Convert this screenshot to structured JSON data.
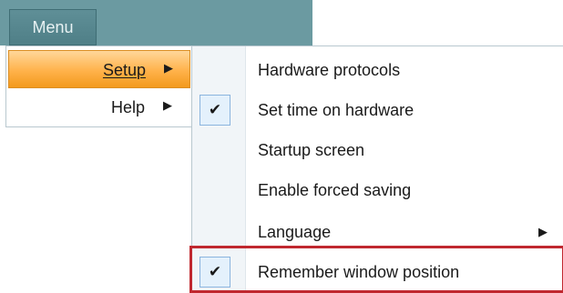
{
  "menubar": {
    "menu_button_label": "Menu"
  },
  "main_menu": {
    "items": [
      {
        "label": "Setup",
        "arrow": "▶"
      },
      {
        "label": "Help",
        "arrow": "▶"
      }
    ]
  },
  "submenu": {
    "items": [
      {
        "label": "Hardware protocols"
      },
      {
        "label": "Set time on hardware",
        "check": "✔"
      },
      {
        "label": "Startup screen"
      },
      {
        "label": "Enable forced saving"
      },
      {
        "label": "Language",
        "arrow": "▶"
      },
      {
        "label": "Remember window position",
        "check": "✔"
      }
    ]
  },
  "colors": {
    "active_item": "#ffb24a",
    "highlight_border": "#c0282f",
    "menubar": "#6b9aa1"
  }
}
